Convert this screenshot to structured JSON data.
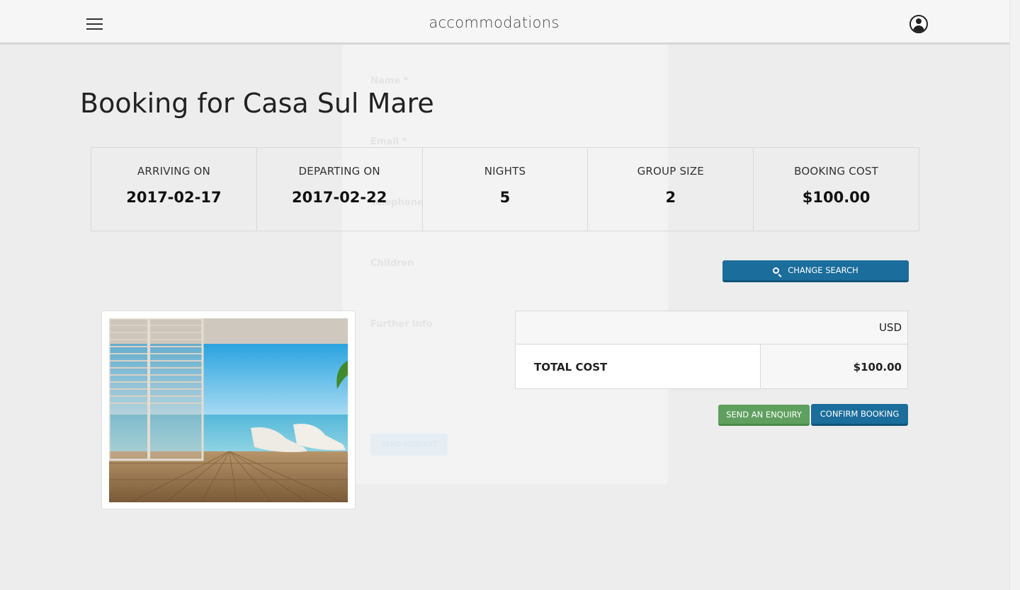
{
  "header": {
    "brand": "accommodations"
  },
  "modal": {
    "labels": [
      "Name *",
      "Email *",
      "Telephone",
      "Children",
      "Further info"
    ],
    "send_request": "SEND REQUEST"
  },
  "page": {
    "title": "Booking for Casa Sul Mare"
  },
  "stats": [
    {
      "label": "ARRIVING ON",
      "value": "2017-02-17"
    },
    {
      "label": "DEPARTING ON",
      "value": "2017-02-22"
    },
    {
      "label": "NIGHTS",
      "value": "5"
    },
    {
      "label": "GROUP SIZE",
      "value": "2"
    },
    {
      "label": "BOOKING COST",
      "value": "$100.00"
    }
  ],
  "actions": {
    "change_search": "CHANGE SEARCH",
    "send_enquiry": "SEND AN ENQUIRY",
    "confirm_booking": "CONFIRM BOOKING"
  },
  "cost": {
    "currency": "USD",
    "total_label": "TOTAL COST",
    "total_value": "$100.00"
  },
  "colors": {
    "primary": "#1b6d9b",
    "success": "#5fa05f",
    "background": "#ededed"
  },
  "icons": {
    "menu": "hamburger-menu-icon",
    "user": "user-account-icon",
    "search": "search-icon"
  }
}
